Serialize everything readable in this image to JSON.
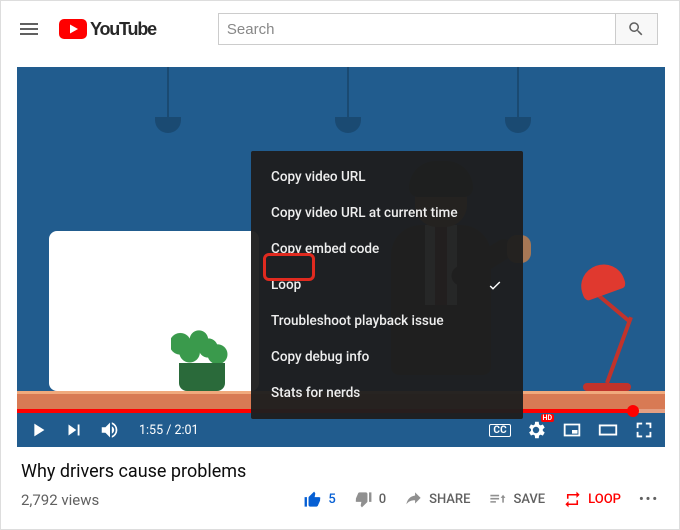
{
  "header": {
    "brand": "YouTube",
    "search_placeholder": "Search"
  },
  "player": {
    "time_current": "1:55",
    "time_total": "2:01",
    "cc_label": "CC",
    "hd_badge": "HD"
  },
  "context_menu": {
    "items": [
      {
        "label": "Copy video URL",
        "checked": false
      },
      {
        "label": "Copy video URL at current time",
        "checked": false
      },
      {
        "label": "Copy embed code",
        "checked": false
      },
      {
        "label": "Loop",
        "checked": true
      },
      {
        "label": "Troubleshoot playback issue",
        "checked": false
      },
      {
        "label": "Copy debug info",
        "checked": false
      },
      {
        "label": "Stats for nerds",
        "checked": false
      }
    ]
  },
  "video": {
    "title": "Why drivers cause problems",
    "views": "2,792 views"
  },
  "actions": {
    "like_count": "5",
    "dislike_count": "0",
    "share_label": "SHARE",
    "save_label": "SAVE",
    "loop_label": "LOOP"
  }
}
